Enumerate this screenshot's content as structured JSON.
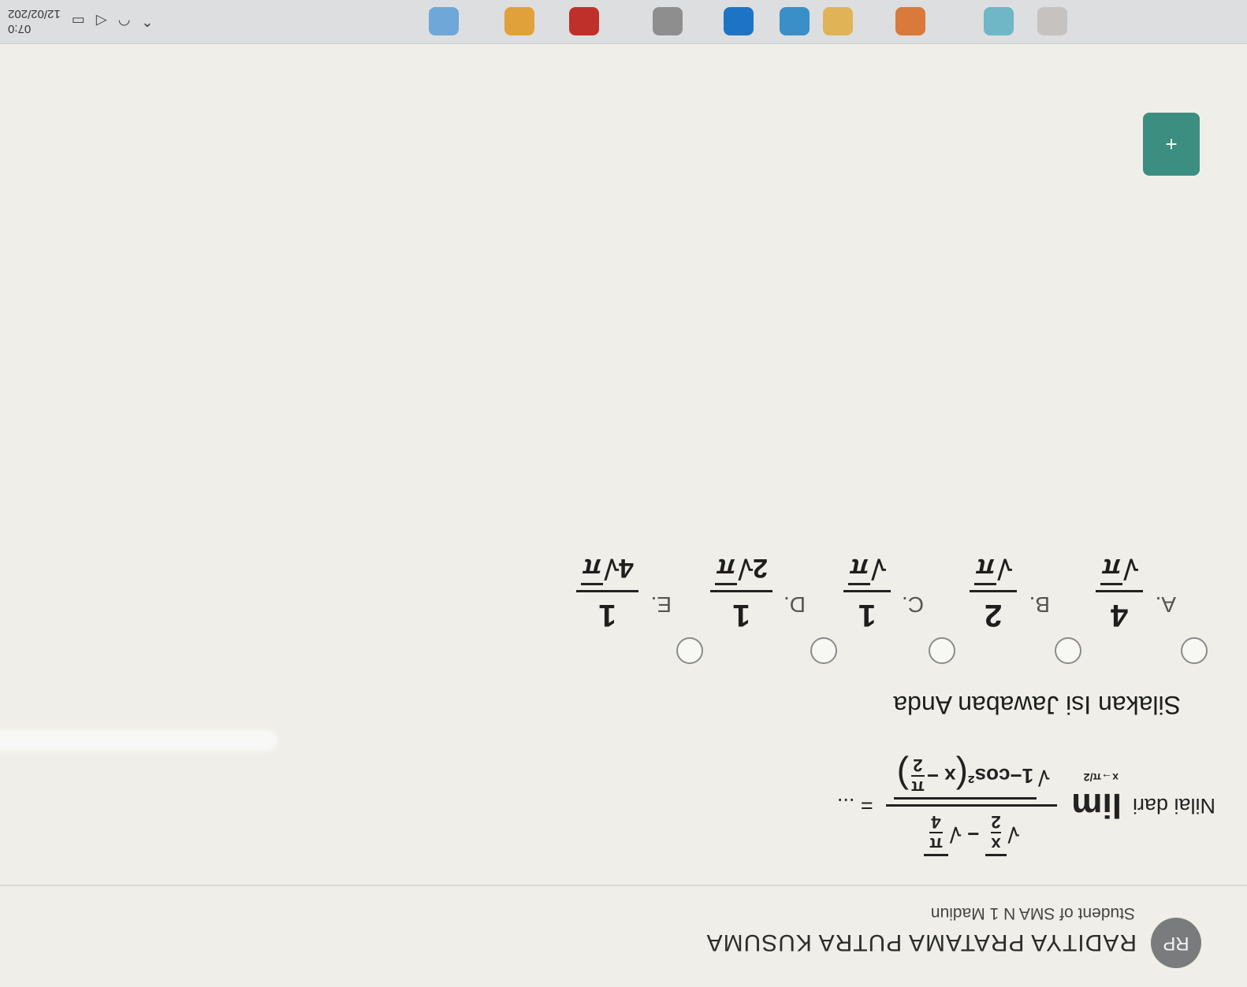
{
  "user": {
    "initials": "RP",
    "name": "RADITYA PRATAMA PUTRA KUSUMA",
    "school": "Student of SMA N 1 Madiun"
  },
  "question": {
    "prefix": "Nilai dari",
    "lim_word": "lim",
    "lim_sub": "x→π/2",
    "num_a_top": "x",
    "num_a_bot": "2",
    "minus": "−",
    "num_b_top": "π",
    "num_b_bot": "4",
    "den_text": "1−cos²",
    "den_x": "x −",
    "den_pi": "π",
    "den_two": "2",
    "suffix": "= ..."
  },
  "instruction": "Silakan Isi Jawaban Anda",
  "options": [
    {
      "letter": "A.",
      "num": "4",
      "den_coef": "",
      "den_rad": "π"
    },
    {
      "letter": "B.",
      "num": "2",
      "den_coef": "",
      "den_rad": "π"
    },
    {
      "letter": "C.",
      "num": "1",
      "den_coef": "",
      "den_rad": "π"
    },
    {
      "letter": "D.",
      "num": "1",
      "den_coef": "2",
      "den_rad": "π"
    },
    {
      "letter": "E.",
      "num": "1",
      "den_coef": "4",
      "den_rad": "π"
    }
  ],
  "fab_icon": "+",
  "taskbar": {
    "time": "07:0",
    "date": "12/02/202"
  }
}
